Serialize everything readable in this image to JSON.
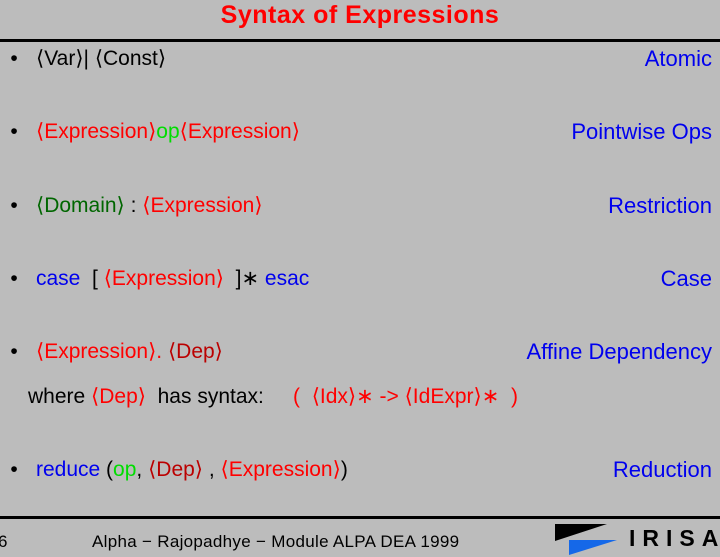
{
  "slide": {
    "title": "Syntax of Expressions",
    "title_color": "#ff0000",
    "background_color": "#bcbcbc"
  },
  "colors": {
    "nonterminal": "#ff0000",
    "nonterminal_dark": "#bb0000",
    "keyword": "#0000ee",
    "operator": "#00dd00",
    "domain": "#006600",
    "plain": "#000000",
    "label": "#0000ee"
  },
  "bullets": [
    {
      "label": "Atomic",
      "tokens": [
        {
          "t": "⟨Var⟩|",
          "c": "plain"
        },
        {
          "t": " ",
          "c": "plain"
        },
        {
          "t": "⟨Const⟩",
          "c": "plain"
        }
      ]
    },
    {
      "label": "Pointwise Ops",
      "tokens": [
        {
          "t": "⟨Expression⟩",
          "c": "nonterminal"
        },
        {
          "t": "op",
          "c": "operator"
        },
        {
          "t": "⟨Expression⟩",
          "c": "nonterminal"
        }
      ]
    },
    {
      "label": "Restriction",
      "tokens": [
        {
          "t": "⟨Domain⟩",
          "c": "domain"
        },
        {
          "t": " : ",
          "c": "plain"
        },
        {
          "t": "⟨Expression⟩",
          "c": "nonterminal"
        }
      ]
    },
    {
      "label": "Case",
      "tokens": [
        {
          "t": "case",
          "c": "keyword"
        },
        {
          "t": "  [ ",
          "c": "plain"
        },
        {
          "t": "⟨Expression⟩",
          "c": "nonterminal"
        },
        {
          "t": "  ]∗ ",
          "c": "plain"
        },
        {
          "t": "esac",
          "c": "keyword"
        }
      ]
    },
    {
      "label": "Affine Dependency",
      "tokens": [
        {
          "t": "⟨Expression⟩",
          "c": "nonterminal"
        },
        {
          "t": ".",
          "c": "nonterminal"
        },
        {
          "t": " ",
          "c": "plain"
        },
        {
          "t": "⟨Dep⟩",
          "c": "nonterminal_dark"
        }
      ]
    },
    {
      "label": "Reduction",
      "tokens": [
        {
          "t": "reduce",
          "c": "keyword"
        },
        {
          "t": " (",
          "c": "plain"
        },
        {
          "t": "op",
          "c": "operator"
        },
        {
          "t": ",",
          "c": "plain"
        },
        {
          "t": " ",
          "c": "plain"
        },
        {
          "t": "⟨Dep⟩",
          "c": "nonterminal_dark"
        },
        {
          "t": " , ",
          "c": "plain"
        },
        {
          "t": "⟨Expression⟩",
          "c": "nonterminal"
        },
        {
          "t": ")",
          "c": "plain"
        }
      ]
    }
  ],
  "sub_line": {
    "tokens": [
      {
        "t": "where ",
        "c": "plain"
      },
      {
        "t": "⟨Dep⟩",
        "c": "nonterminal"
      },
      {
        "t": "  has syntax:",
        "c": "plain"
      },
      {
        "t": "     ",
        "c": "plain"
      },
      {
        "t": "(  ⟨Idx⟩∗ -> ⟨IdExpr⟩∗  )",
        "c": "nonterminal"
      }
    ]
  },
  "footer": {
    "page_number": "6",
    "text": "Alpha − Rajopadhye − Module ALPA DEA 1999",
    "logo_text": "IRISA",
    "logo_mark_top_color": "#000000",
    "logo_mark_bottom_color": "#1568e8"
  }
}
